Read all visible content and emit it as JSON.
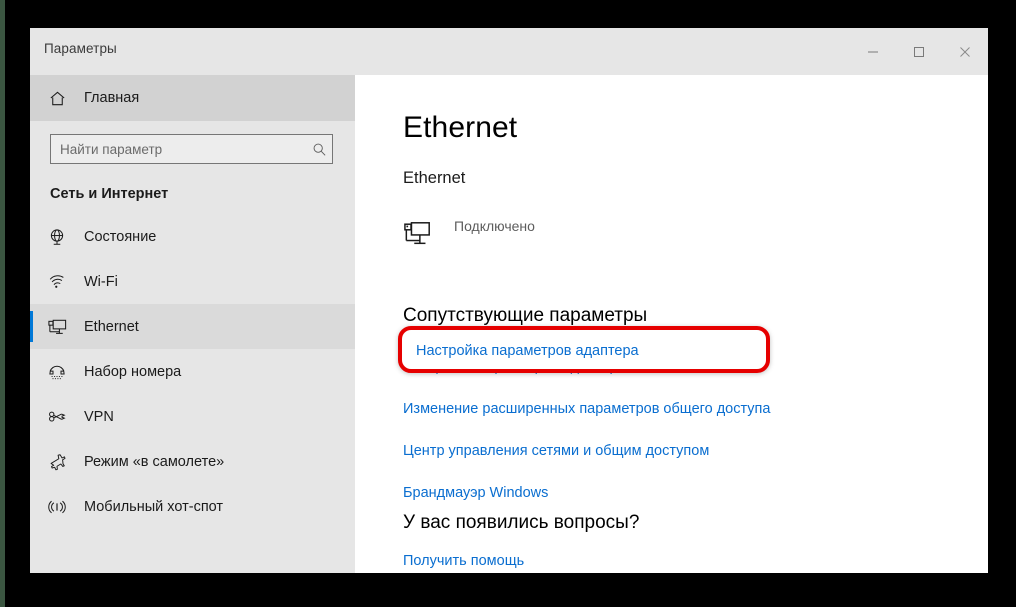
{
  "window": {
    "title": "Параметры",
    "controls": [
      {
        "name": "minimize",
        "glyph": "minimize-icon"
      },
      {
        "name": "maximize",
        "glyph": "maximize-icon"
      },
      {
        "name": "close",
        "glyph": "close-icon"
      }
    ]
  },
  "sidebar": {
    "home": {
      "label": "Главная",
      "icon": "home-icon"
    },
    "search": {
      "placeholder": "Найти параметр",
      "value": "",
      "icon": "search-icon"
    },
    "category": "Сеть и Интернет",
    "items": [
      {
        "label": "Состояние",
        "icon": "globe-icon",
        "selected": false
      },
      {
        "label": "Wi-Fi",
        "icon": "wifi-icon",
        "selected": false
      },
      {
        "label": "Ethernet",
        "icon": "ethernet-icon",
        "selected": true
      },
      {
        "label": "Набор номера",
        "icon": "dialup-phone-icon",
        "selected": false
      },
      {
        "label": "VPN",
        "icon": "vpn-key-icon",
        "selected": false
      },
      {
        "label": "Режим «в самолете»",
        "icon": "airplane-icon",
        "selected": false
      },
      {
        "label": "Мобильный хот-спот",
        "icon": "hotspot-icon",
        "selected": false
      }
    ]
  },
  "content": {
    "page_title": "Ethernet",
    "subhead": "Ethernet",
    "adapter": {
      "icon": "ethernet-adapter-icon",
      "name": "",
      "name_redacted": true,
      "status": "Подключено"
    },
    "related_heading": "Сопутствующие параметры",
    "links": [
      "Настройка параметров адаптера",
      "Изменение расширенных параметров общего доступа",
      "Центр управления сетями и общим доступом",
      "Брандмауэр Windows"
    ],
    "questions_heading": "У вас появились вопросы?",
    "help_link": "Получить помощь"
  },
  "annotation": {
    "shape": "rounded-rectangle",
    "color": "#e60000",
    "highlighted_label": "Настройка параметров адаптера"
  },
  "colors": {
    "accent": "#0078d7",
    "link": "#0a6ed0",
    "sidebar_bg": "#e6e6e6",
    "titlebar_bg": "#e6e6e6",
    "annotation": "#e60000"
  }
}
